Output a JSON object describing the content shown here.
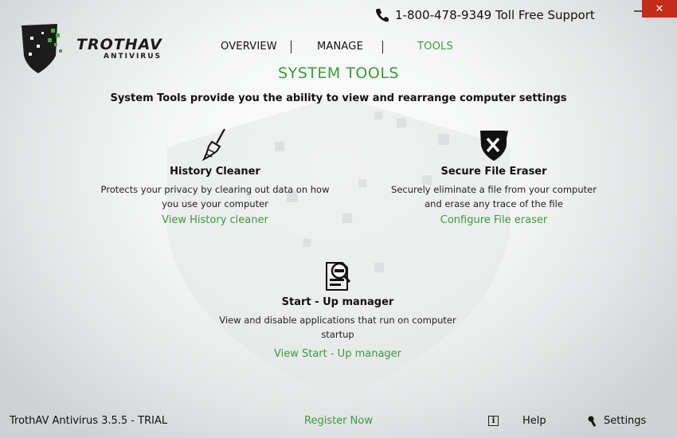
{
  "brand": {
    "logo_text": "TROTHAV",
    "logo_sub": "ANTIVIRUS",
    "accent": "#3a9a3c"
  },
  "header": {
    "phone_icon": "phone-icon",
    "phone": "1-800-478-9349 Toll Free Support"
  },
  "window": {
    "minimize_icon": "minimize-icon",
    "close_icon": "close-icon"
  },
  "nav": {
    "tabs": [
      {
        "label": "OVERVIEW",
        "active": false
      },
      {
        "label": "MANAGE",
        "active": false
      },
      {
        "label": "TOOLS",
        "active": true
      }
    ]
  },
  "main": {
    "title": "SYSTEM TOOLS",
    "subtitle": "System Tools provide you the ability to view and rearrange computer settings",
    "tools": [
      {
        "icon": "broom-icon",
        "name": "History Cleaner",
        "desc_line1": "Protects your privacy by clearing out data on how",
        "desc_line2": "you use your computer",
        "link": "View History cleaner"
      },
      {
        "icon": "shield-x-icon",
        "name": "Secure File Eraser",
        "desc_line1": "Securely eliminate a file from your computer",
        "desc_line2": "and erase any trace of the file",
        "link": "Configure File eraser"
      },
      {
        "icon": "startup-manager-icon",
        "name": "Start - Up manager",
        "desc_line1": "View and disable applications that run on computer",
        "desc_line2": "startup",
        "link": "View Start - Up manager"
      }
    ]
  },
  "footer": {
    "version": "TrothAV Antivirus 3.5.5 - TRIAL",
    "register": "Register Now",
    "info_icon": "info-icon",
    "help": "Help",
    "settings_icon": "wrench-icon",
    "settings": "Settings"
  }
}
